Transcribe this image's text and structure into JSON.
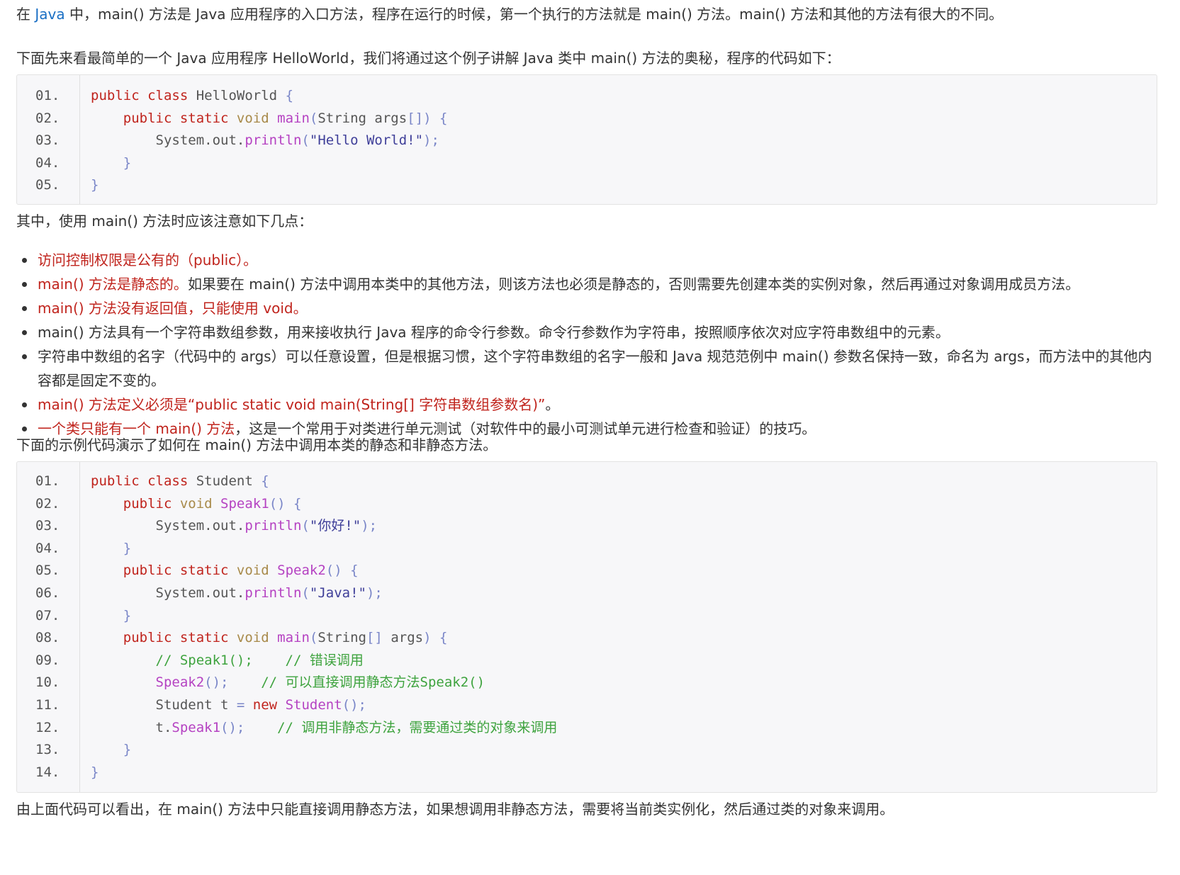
{
  "intro": {
    "p1_before": "在 ",
    "p1_link": "Java",
    "p1_after": " 中，main() 方法是 Java 应用程序的入口方法，程序在运行的时候，第一个执行的方法就是 main() 方法。main() 方法和其他的方法有很大的不同。",
    "p2": "下面先来看最简单的一个 Java 应用程序 HelloWorld，我们将通过这个例子讲解 Java 类中 main() 方法的奥秘，程序的代码如下："
  },
  "code1": {
    "line_numbers": [
      "01.",
      "02.",
      "03.",
      "04.",
      "05."
    ],
    "lines": [
      [
        {
          "t": "public class",
          "c": "kw"
        },
        {
          "t": " HelloWorld ",
          "c": "pl"
        },
        {
          "t": "{",
          "c": "pu"
        }
      ],
      [
        {
          "t": "    ",
          "c": "pl"
        },
        {
          "t": "public static",
          "c": "kw"
        },
        {
          "t": " void ",
          "c": "vo"
        },
        {
          "t": "main",
          "c": "mt"
        },
        {
          "t": "(",
          "c": "pu"
        },
        {
          "t": "String args",
          "c": "pl"
        },
        {
          "t": "[])",
          "c": "pu"
        },
        {
          "t": " {",
          "c": "pu"
        }
      ],
      [
        {
          "t": "        System.out.",
          "c": "pl"
        },
        {
          "t": "println",
          "c": "mt"
        },
        {
          "t": "(",
          "c": "pu"
        },
        {
          "t": "\"Hello World!\"",
          "c": "st"
        },
        {
          "t": ");",
          "c": "pu"
        }
      ],
      [
        {
          "t": "    ",
          "c": "pl"
        },
        {
          "t": "}",
          "c": "pu"
        }
      ],
      [
        {
          "t": "}",
          "c": "pu"
        }
      ]
    ]
  },
  "notes_intro": "其中，使用 main() 方法时应该注意如下几点：",
  "points": [
    [
      {
        "t": "访问控制权限是公有的（public）。",
        "red": true
      }
    ],
    [
      {
        "t": "main() 方法是静态的。",
        "red": true
      },
      {
        "t": "如果要在 main() 方法中调用本类中的其他方法，则该方法也必须是静态的，否则需要先创建本类的实例对象，然后再通过对象调用成员方法。",
        "red": false
      }
    ],
    [
      {
        "t": "main() 方法没有返回值，只能使用 void。",
        "red": true
      }
    ],
    [
      {
        "t": "main() 方法具有一个字符串数组参数，用来接收执行 Java 程序的命令行参数。命令行参数作为字符串，按照顺序依次对应字符串数组中的元素。",
        "red": false
      }
    ],
    [
      {
        "t": "字符串中数组的名字（代码中的 args）可以任意设置，但是根据习惯，这个字符串数组的名字一般和 Java 规范范例中 main() 参数名保持一致，命名为 args，而方法中的其他内容都是固定不变的。",
        "red": false
      }
    ],
    [
      {
        "t": "main() 方法定义必须是“public static void main(String[] 字符串数组参数名)”",
        "red": true
      },
      {
        "t": "。",
        "red": false
      }
    ],
    [
      {
        "t": "一个类只能有一个 main() 方法",
        "red": true
      },
      {
        "t": "，这是一个常用于对类进行单元测试（对软件中的最小可测试单元进行检查和验证）的技巧。",
        "red": false
      }
    ]
  ],
  "p3": "下面的示例代码演示了如何在 main() 方法中调用本类的静态和非静态方法。",
  "code2": {
    "line_numbers": [
      "01.",
      "02.",
      "03.",
      "04.",
      "05.",
      "06.",
      "07.",
      "08.",
      "09.",
      "10.",
      "11.",
      "12.",
      "13.",
      "14."
    ],
    "lines": [
      [
        {
          "t": "public class",
          "c": "kw"
        },
        {
          "t": " Student ",
          "c": "pl"
        },
        {
          "t": "{",
          "c": "pu"
        }
      ],
      [
        {
          "t": "    ",
          "c": "pl"
        },
        {
          "t": "public",
          "c": "kw"
        },
        {
          "t": " void ",
          "c": "vo"
        },
        {
          "t": "Speak1",
          "c": "mt"
        },
        {
          "t": "() {",
          "c": "pu"
        }
      ],
      [
        {
          "t": "        System.out.",
          "c": "pl"
        },
        {
          "t": "println",
          "c": "mt"
        },
        {
          "t": "(",
          "c": "pu"
        },
        {
          "t": "\"你好!\"",
          "c": "st"
        },
        {
          "t": ");",
          "c": "pu"
        }
      ],
      [
        {
          "t": "    ",
          "c": "pl"
        },
        {
          "t": "}",
          "c": "pu"
        }
      ],
      [
        {
          "t": "    ",
          "c": "pl"
        },
        {
          "t": "public static",
          "c": "kw"
        },
        {
          "t": " void ",
          "c": "vo"
        },
        {
          "t": "Speak2",
          "c": "mt"
        },
        {
          "t": "() {",
          "c": "pu"
        }
      ],
      [
        {
          "t": "        System.out.",
          "c": "pl"
        },
        {
          "t": "println",
          "c": "mt"
        },
        {
          "t": "(",
          "c": "pu"
        },
        {
          "t": "\"Java!\"",
          "c": "st"
        },
        {
          "t": ");",
          "c": "pu"
        }
      ],
      [
        {
          "t": "    ",
          "c": "pl"
        },
        {
          "t": "}",
          "c": "pu"
        }
      ],
      [
        {
          "t": "    ",
          "c": "pl"
        },
        {
          "t": "public static",
          "c": "kw"
        },
        {
          "t": " void ",
          "c": "vo"
        },
        {
          "t": "main",
          "c": "mt"
        },
        {
          "t": "(",
          "c": "pu"
        },
        {
          "t": "String",
          "c": "pl"
        },
        {
          "t": "[]",
          "c": "pu"
        },
        {
          "t": " args",
          "c": "pl"
        },
        {
          "t": ") {",
          "c": "pu"
        }
      ],
      [
        {
          "t": "        ",
          "c": "pl"
        },
        {
          "t": "// Speak1();    // 错误调用",
          "c": "cm"
        }
      ],
      [
        {
          "t": "        ",
          "c": "pl"
        },
        {
          "t": "Speak2",
          "c": "mt"
        },
        {
          "t": "();    ",
          "c": "pu"
        },
        {
          "t": "// 可以直接调用静态方法Speak2()",
          "c": "cm"
        }
      ],
      [
        {
          "t": "        Student t ",
          "c": "pl"
        },
        {
          "t": "=",
          "c": "pu"
        },
        {
          "t": " new",
          "c": "kw"
        },
        {
          "t": " Student",
          "c": "mt"
        },
        {
          "t": "();",
          "c": "pu"
        }
      ],
      [
        {
          "t": "        t.",
          "c": "pl"
        },
        {
          "t": "Speak1",
          "c": "mt"
        },
        {
          "t": "();    ",
          "c": "pu"
        },
        {
          "t": "// 调用非静态方法，需要通过类的对象来调用",
          "c": "cm"
        }
      ],
      [
        {
          "t": "    ",
          "c": "pl"
        },
        {
          "t": "}",
          "c": "pu"
        }
      ],
      [
        {
          "t": "}",
          "c": "pu"
        }
      ]
    ]
  },
  "p4": "由上面代码可以看出，在 main() 方法中只能直接调用静态方法，如果想调用非静态方法，需要将当前类实例化，然后通过类的对象来调用。"
}
